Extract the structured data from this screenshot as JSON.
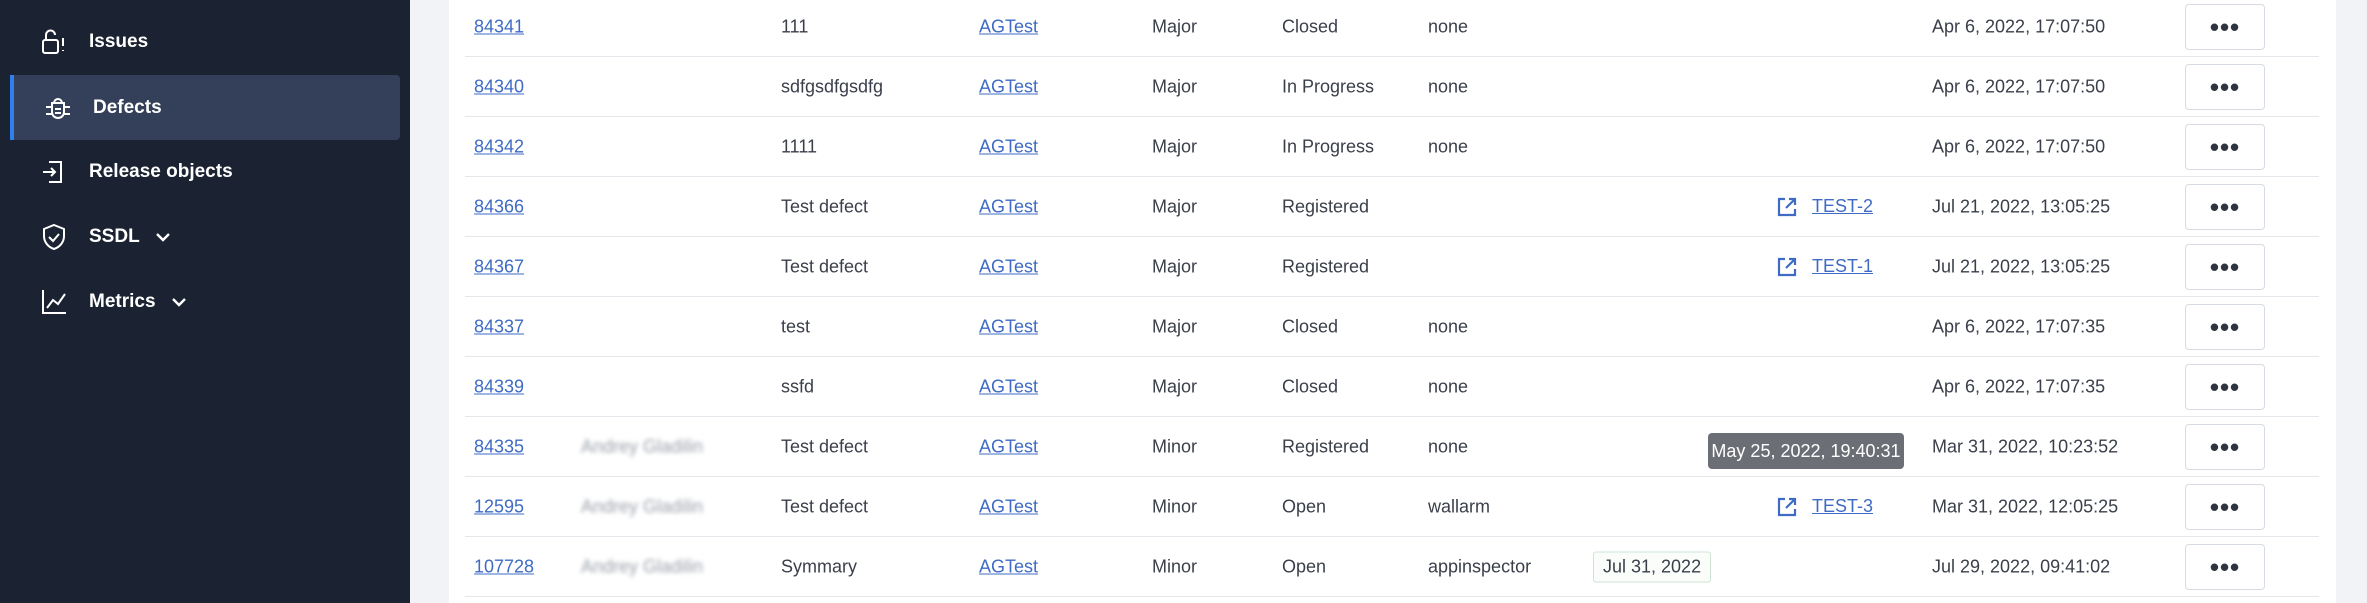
{
  "sidebar": {
    "items": [
      {
        "label": "Issues",
        "icon": "lock-alert-icon"
      },
      {
        "label": "Defects",
        "icon": "bug-icon"
      },
      {
        "label": "Release objects",
        "icon": "sign-in-icon"
      },
      {
        "label": "SSDL",
        "icon": "shield-check-icon"
      },
      {
        "label": "Metrics",
        "icon": "chart-line-icon"
      }
    ]
  },
  "colors": {
    "sidebar_bg": "#1b2232",
    "active_item_bg": "#34405a",
    "link": "#3f6bc4",
    "tooltip_bg": "#6b6e74"
  },
  "rows": [
    {
      "id": "84341",
      "assignee": "",
      "title": "111",
      "project": "AGTest",
      "severity": "Major",
      "status": "Closed",
      "scanner": "none",
      "due": "",
      "tracker": "",
      "date": "Apr 6, 2022, 17:07:50"
    },
    {
      "id": "84340",
      "assignee": "",
      "title": "sdfgsdfgsdfg",
      "project": "AGTest",
      "severity": "Major",
      "status": "In Progress",
      "scanner": "none",
      "due": "",
      "tracker": "",
      "date": "Apr 6, 2022, 17:07:50"
    },
    {
      "id": "84342",
      "assignee": "",
      "title": "1111",
      "project": "AGTest",
      "severity": "Major",
      "status": "In Progress",
      "scanner": "none",
      "due": "",
      "tracker": "",
      "date": "Apr 6, 2022, 17:07:50"
    },
    {
      "id": "84366",
      "assignee": "",
      "title": "Test defect",
      "project": "AGTest",
      "severity": "Major",
      "status": "Registered",
      "scanner": "",
      "due": "",
      "tracker": "TEST-2",
      "date": "Jul 21, 2022, 13:05:25"
    },
    {
      "id": "84367",
      "assignee": "",
      "title": "Test defect",
      "project": "AGTest",
      "severity": "Major",
      "status": "Registered",
      "scanner": "",
      "due": "",
      "tracker": "TEST-1",
      "date": "Jul 21, 2022, 13:05:25"
    },
    {
      "id": "84337",
      "assignee": "",
      "title": "test",
      "project": "AGTest",
      "severity": "Major",
      "status": "Closed",
      "scanner": "none",
      "due": "",
      "tracker": "",
      "date": "Apr 6, 2022, 17:07:35"
    },
    {
      "id": "84339",
      "assignee": "",
      "title": "ssfd",
      "project": "AGTest",
      "severity": "Major",
      "status": "Closed",
      "scanner": "none",
      "due": "",
      "tracker": "",
      "date": "Apr 6, 2022, 17:07:35"
    },
    {
      "id": "84335",
      "assignee": "Andrey Gladilin",
      "title": "Test defect",
      "project": "AGTest",
      "severity": "Minor",
      "status": "Registered",
      "scanner": "none",
      "due": "",
      "tracker": "",
      "date": "Mar 31, 2022, 10:23:52"
    },
    {
      "id": "12595",
      "assignee": "Andrey Gladilin",
      "title": "Test defect",
      "project": "AGTest",
      "severity": "Minor",
      "status": "Open",
      "scanner": "wallarm",
      "due": "",
      "tracker": "TEST-3",
      "date": "Mar 31, 2022, 12:05:25"
    },
    {
      "id": "107728",
      "assignee": "Andrey Gladilin",
      "title": "Symmary",
      "project": "AGTest",
      "severity": "Minor",
      "status": "Open",
      "scanner": "appinspector",
      "due": "Jul 31, 2022",
      "tracker": "",
      "date": "Jul 29, 2022, 09:41:02"
    }
  ],
  "menu_label": "•••",
  "tooltip": "May 25, 2022, 19:40:31"
}
